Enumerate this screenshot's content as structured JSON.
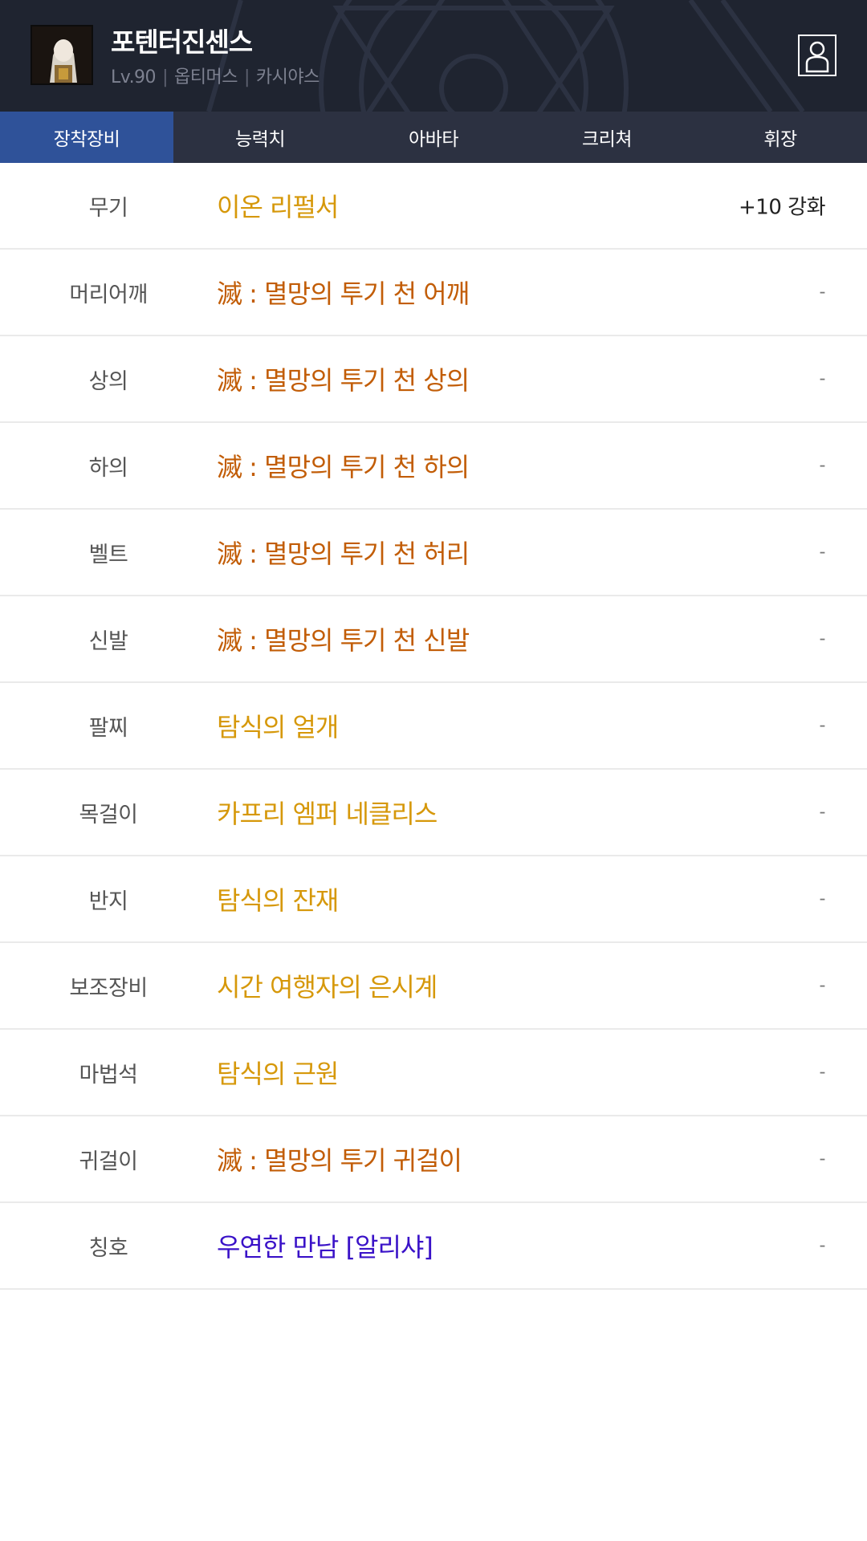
{
  "header": {
    "character_name": "포텐터진센스",
    "level": "Lv.90",
    "job": "옵티머스",
    "server": "카시야스",
    "separator": "|",
    "avatar_icon": "character-portrait-icon",
    "profile_icon": "user-profile-icon"
  },
  "tabs": [
    {
      "label": "장착장비",
      "active": true
    },
    {
      "label": "능력치",
      "active": false
    },
    {
      "label": "아바타",
      "active": false
    },
    {
      "label": "크리쳐",
      "active": false
    },
    {
      "label": "휘장",
      "active": false
    }
  ],
  "colors": {
    "header_bg": "#1f2430",
    "tab_bg": "#2c3141",
    "tab_active": "#2f5299",
    "item_gold": "#d6980a",
    "item_red": "#c25d07",
    "item_purple": "#3a12c8"
  },
  "equipment": [
    {
      "slot": "무기",
      "item": "이온 리펄서",
      "reinforce": "+10 강화",
      "tier": "gold"
    },
    {
      "slot": "머리어깨",
      "item": "滅 : 멸망의 투기 천 어깨",
      "reinforce": "-",
      "tier": "red"
    },
    {
      "slot": "상의",
      "item": "滅 : 멸망의 투기 천 상의",
      "reinforce": "-",
      "tier": "red"
    },
    {
      "slot": "하의",
      "item": "滅 : 멸망의 투기 천 하의",
      "reinforce": "-",
      "tier": "red"
    },
    {
      "slot": "벨트",
      "item": "滅 : 멸망의 투기 천 허리",
      "reinforce": "-",
      "tier": "red"
    },
    {
      "slot": "신발",
      "item": "滅 : 멸망의 투기 천 신발",
      "reinforce": "-",
      "tier": "red"
    },
    {
      "slot": "팔찌",
      "item": "탐식의 얼개",
      "reinforce": "-",
      "tier": "gold"
    },
    {
      "slot": "목걸이",
      "item": "카프리 엠퍼 네클리스",
      "reinforce": "-",
      "tier": "gold"
    },
    {
      "slot": "반지",
      "item": "탐식의 잔재",
      "reinforce": "-",
      "tier": "gold"
    },
    {
      "slot": "보조장비",
      "item": "시간 여행자의 은시계",
      "reinforce": "-",
      "tier": "gold"
    },
    {
      "slot": "마법석",
      "item": "탐식의 근원",
      "reinforce": "-",
      "tier": "gold"
    },
    {
      "slot": "귀걸이",
      "item": "滅 : 멸망의 투기 귀걸이",
      "reinforce": "-",
      "tier": "red"
    },
    {
      "slot": "칭호",
      "item": "우연한 만남 [알리샤]",
      "reinforce": "-",
      "tier": "purple"
    }
  ]
}
